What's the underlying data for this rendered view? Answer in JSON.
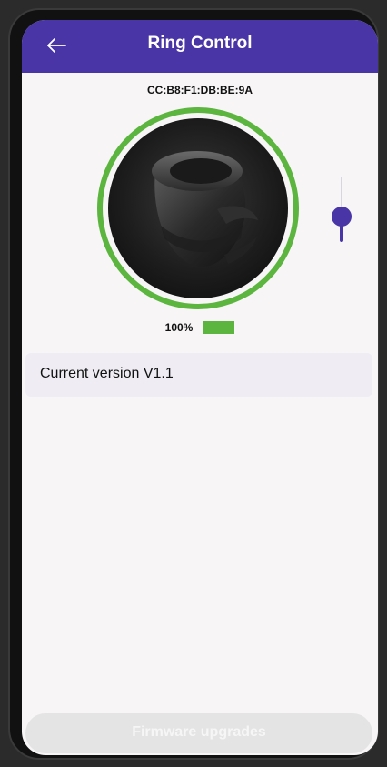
{
  "header": {
    "title": "Ring Control",
    "back_icon": "arrow-left-icon",
    "background": "#4a35a7"
  },
  "device": {
    "mac_address": "CC:B8:F1:DB:BE:9A",
    "ring_border_color": "#5bb53f"
  },
  "slider": {
    "value_fraction": 0.35,
    "color": "#4a35a7"
  },
  "battery": {
    "percent_text": "100%",
    "level": 1.0,
    "color": "#5bb53f"
  },
  "version": {
    "label": "Current version V1.1"
  },
  "footer": {
    "button_label": "Firmware upgrades"
  }
}
